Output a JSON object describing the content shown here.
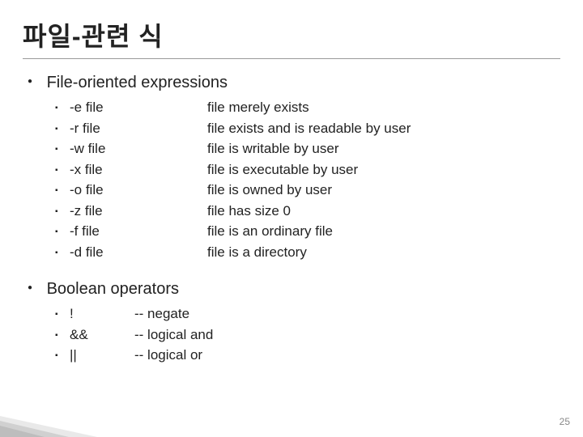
{
  "title": "파일-관련 식",
  "page_number": "25",
  "sections": [
    {
      "heading": "File-oriented expressions",
      "col_style": "wide",
      "items": [
        {
          "left": "-e file",
          "right": "file merely exists"
        },
        {
          "left": "-r file",
          "right": "file exists and is readable by user"
        },
        {
          "left": "-w file",
          "right": "file is writable by user"
        },
        {
          "left": "-x file",
          "right": "file is executable by user"
        },
        {
          "left": "-o file",
          "right": "file is owned by user"
        },
        {
          "left": "-z file",
          "right": "file has size 0"
        },
        {
          "left": "-f file",
          "right": "file is an ordinary file"
        },
        {
          "left": "-d file",
          "right": "file is a directory"
        }
      ]
    },
    {
      "heading": "Boolean operators",
      "col_style": "narrow",
      "items": [
        {
          "left": "!",
          "right": "-- negate"
        },
        {
          "left": "&&",
          "right": "-- logical and"
        },
        {
          "left": "||",
          "right": "-- logical or"
        }
      ]
    }
  ]
}
